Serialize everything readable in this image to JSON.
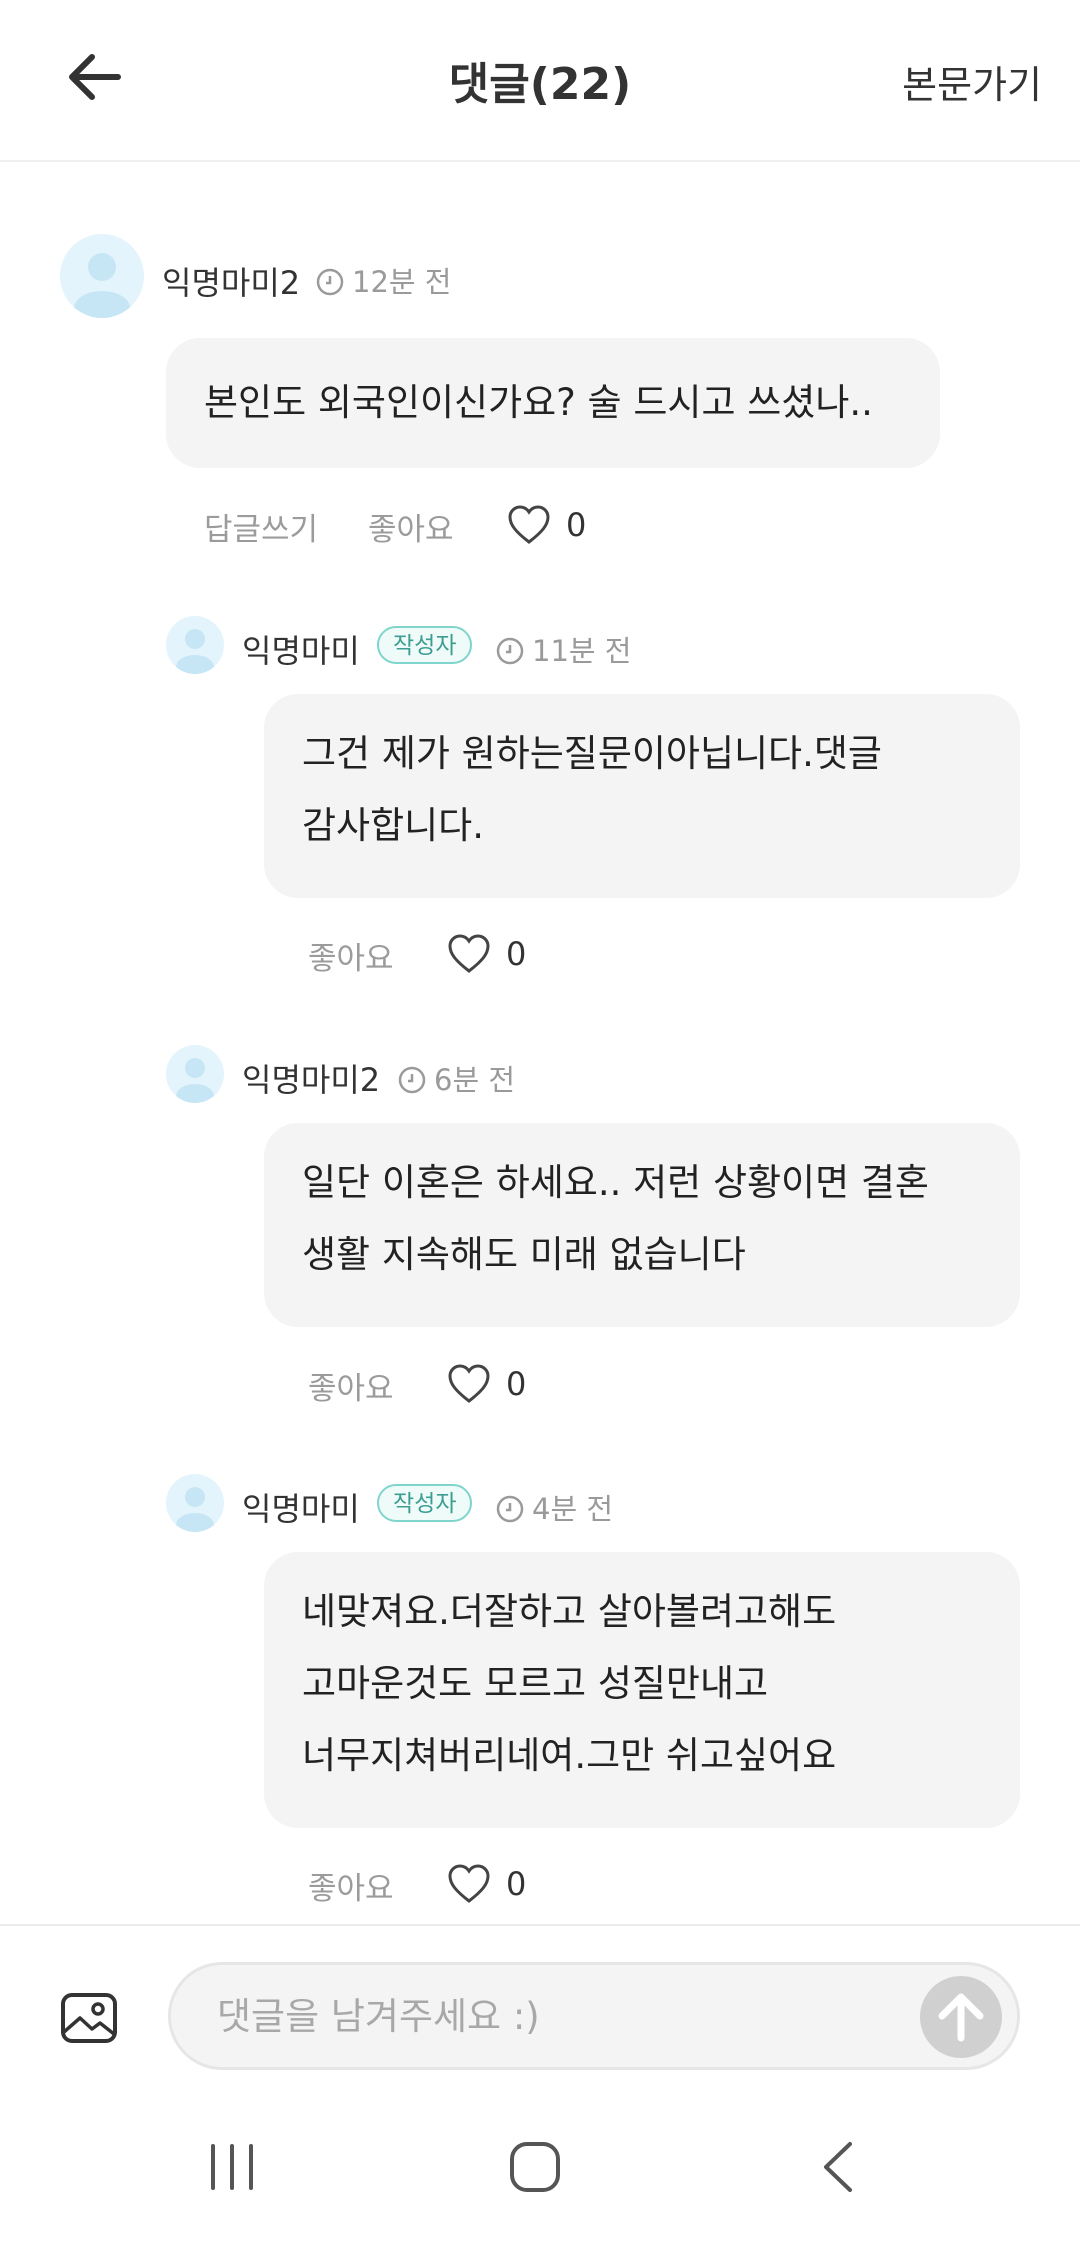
{
  "header": {
    "title": "댓글(22)",
    "link": "본문가기"
  },
  "comments": [
    {
      "user": "익명마미2",
      "time": "12분 전",
      "lines": [
        "본인도 외국인이신가요? 술 드시고 쓰셨나.."
      ],
      "reply_label": "답글쓰기",
      "like_label": "좋아요",
      "likes": "0"
    },
    {
      "user": "익명마미",
      "badge": "작성자",
      "time": "11분 전",
      "lines": [
        "그건 제가 원하는질문이아닙니다.댓글",
        "감사합니다."
      ],
      "like_label": "좋아요",
      "likes": "0"
    },
    {
      "user": "익명마미2",
      "time": "6분 전",
      "lines": [
        "일단 이혼은 하세요.. 저런 상황이면 결혼",
        "생활 지속해도 미래 없습니다"
      ],
      "like_label": "좋아요",
      "likes": "0"
    },
    {
      "user": "익명마미",
      "badge": "작성자",
      "time": "4분 전",
      "lines": [
        "네맞져요.더잘하고 살아볼려고해도",
        "고마운것도 모르고 성질만내고",
        "너무지쳐버리네여.그만 쉬고싶어요"
      ],
      "like_label": "좋아요",
      "likes": "0"
    }
  ],
  "input": {
    "placeholder": "댓글을 남겨주세요 :)"
  },
  "colors": {
    "author_badge_border": "#7fd5cc",
    "bubble_bg": "#f4f4f4",
    "send_button": "#d0d0d0"
  }
}
